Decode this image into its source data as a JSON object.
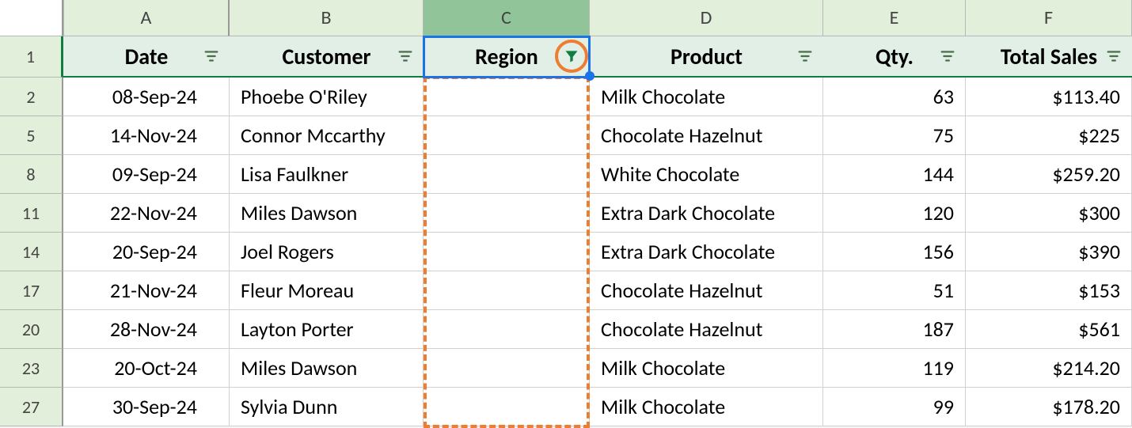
{
  "columnLetters": [
    "A",
    "B",
    "C",
    "D",
    "E",
    "F"
  ],
  "columns": [
    {
      "label": "Date",
      "filterActive": false
    },
    {
      "label": "Customer",
      "filterActive": false
    },
    {
      "label": "Region",
      "filterActive": true,
      "selected": true,
      "highlight": true
    },
    {
      "label": "Product",
      "filterActive": false
    },
    {
      "label": "Qty.",
      "filterActive": false
    },
    {
      "label": "Total Sales",
      "filterActive": false
    }
  ],
  "rows": [
    {
      "n": 2,
      "date": "08-Sep-24",
      "customer": "Phoebe O'Riley",
      "region": "",
      "product": "Milk Chocolate",
      "qty": "63",
      "total": "$113.40"
    },
    {
      "n": 5,
      "date": "14-Nov-24",
      "customer": "Connor Mccarthy",
      "region": "",
      "product": "Chocolate Hazelnut",
      "qty": "75",
      "total": "$225"
    },
    {
      "n": 8,
      "date": "09-Sep-24",
      "customer": "Lisa Faulkner",
      "region": "",
      "product": "White Chocolate",
      "qty": "144",
      "total": "$259.20"
    },
    {
      "n": 11,
      "date": "22-Nov-24",
      "customer": "Miles Dawson",
      "region": "",
      "product": "Extra Dark Chocolate",
      "qty": "120",
      "total": "$300"
    },
    {
      "n": 14,
      "date": "20-Sep-24",
      "customer": "Joel Rogers",
      "region": "",
      "product": "Extra Dark Chocolate",
      "qty": "156",
      "total": "$390"
    },
    {
      "n": 17,
      "date": "21-Nov-24",
      "customer": "Fleur Moreau",
      "region": "",
      "product": "Chocolate Hazelnut",
      "qty": "51",
      "total": "$153"
    },
    {
      "n": 20,
      "date": "28-Nov-24",
      "customer": "Layton Porter",
      "region": "",
      "product": "Chocolate Hazelnut",
      "qty": "187",
      "total": "$561"
    },
    {
      "n": 23,
      "date": "20-Oct-24",
      "customer": "Miles Dawson",
      "region": "",
      "product": "Milk Chocolate",
      "qty": "119",
      "total": "$214.20"
    },
    {
      "n": 27,
      "date": "30-Sep-24",
      "customer": "Sylvia Dunn",
      "region": "",
      "product": "Milk Chocolate",
      "qty": "99",
      "total": "$178.20"
    }
  ],
  "activeRow": 1
}
